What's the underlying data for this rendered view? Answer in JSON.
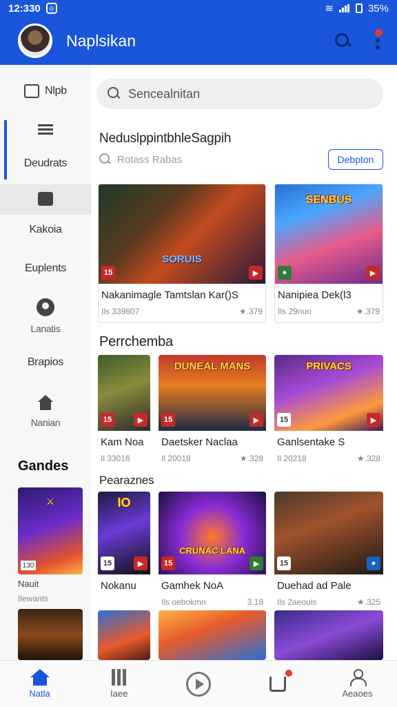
{
  "status_bar": {
    "time": "12:330",
    "battery": "35%"
  },
  "app_bar": {
    "title": "Naplsikan"
  },
  "sidebar": {
    "items": [
      {
        "label": "Nlpb"
      },
      {
        "label": "Deudrats"
      },
      {
        "label": ""
      },
      {
        "label": "Kakoia"
      },
      {
        "label": "Euplents"
      },
      {
        "label": "Lanatis"
      },
      {
        "label": "Brapios"
      },
      {
        "label": "Nanian"
      }
    ],
    "games_title": "Gandes",
    "game_card": {
      "name": "Nauit",
      "meta": "Ilewants",
      "badge": "130"
    }
  },
  "search": {
    "placeholder": "Sencealnitan"
  },
  "featured": {
    "title": "NeduslppintbhleSagpih",
    "subsearch": "Rotass Rabas",
    "detail_button": "Debpton",
    "cards": [
      {
        "name": "Nakanimagle Tamtslan Kar()S",
        "meta_left": "Ils 339807",
        "meta_right": "★.379",
        "art_title": "SORUIS"
      },
      {
        "name": "Nanipiea Dek(l3",
        "meta_left": "Ils 29nuo",
        "meta_right": "★.379",
        "art_title": "SENBUS"
      }
    ]
  },
  "section2": {
    "title": "Perrchemba",
    "cards": [
      {
        "name": "Kam Noa",
        "meta_left": "Il 33016",
        "meta_right": ""
      },
      {
        "name": "Daetsker Naclaa",
        "meta_left": "Il 20018",
        "meta_right": "★.328",
        "art_title": "DUNEAL MANS"
      },
      {
        "name": "Ganlsentake S",
        "meta_left": "Il 20218",
        "meta_right": "★.328",
        "art_title": "PRIVACS"
      }
    ]
  },
  "section3": {
    "title": "Pearaznes",
    "cards": [
      {
        "name": "Nokanu",
        "meta_left": "",
        "meta_right": ""
      },
      {
        "name": "Gamhek NoA",
        "meta_left": "Ils oebokmn",
        "meta_right": "3.18",
        "art_title": "CRUNAC LANA"
      },
      {
        "name": "Duehad ad Pale",
        "meta_left": "Ils 2aeouis",
        "meta_right": "★.325"
      }
    ]
  },
  "bottom_nav": [
    {
      "label": "Natla"
    },
    {
      "label": "Iaee"
    },
    {
      "label": ""
    },
    {
      "label": ""
    },
    {
      "label": "Aeaoes"
    }
  ]
}
